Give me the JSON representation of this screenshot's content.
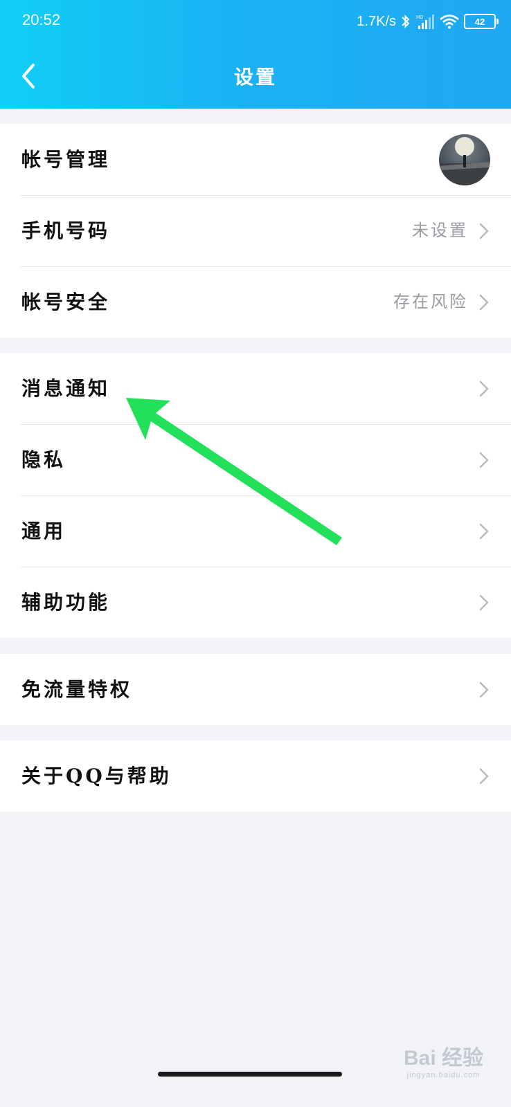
{
  "status_bar": {
    "time": "20:52",
    "net_speed": "1.7K/s",
    "signal_badge": "HD",
    "battery": "42",
    "icons": [
      "bluetooth-icon",
      "signal-icon",
      "wifi-icon",
      "battery-icon"
    ]
  },
  "nav": {
    "title": "设置",
    "back_icon": "chevron-left-icon"
  },
  "groups": [
    {
      "rows": [
        {
          "label": "帐号管理",
          "value": "",
          "trailing": "avatar"
        },
        {
          "label": "手机号码",
          "value": "未设置",
          "trailing": "chevron"
        },
        {
          "label": "帐号安全",
          "value": "存在风险",
          "trailing": "chevron"
        }
      ]
    },
    {
      "rows": [
        {
          "label": "消息通知",
          "value": "",
          "trailing": "chevron"
        },
        {
          "label": "隐私",
          "value": "",
          "trailing": "chevron"
        },
        {
          "label": "通用",
          "value": "",
          "trailing": "chevron"
        },
        {
          "label": "辅助功能",
          "value": "",
          "trailing": "chevron"
        }
      ]
    },
    {
      "rows": [
        {
          "label": "免流量特权",
          "value": "",
          "trailing": "chevron"
        }
      ]
    },
    {
      "rows": [
        {
          "label": "关于QQ与帮助",
          "value": "",
          "trailing": "chevron"
        }
      ]
    }
  ],
  "watermark": {
    "main": "Bai 经验",
    "sub": "jingyan.baidu.com"
  },
  "colors": {
    "header_start": "#10cff5",
    "header_end": "#20a7f2",
    "arrow": "#22e05a",
    "background": "#f2f3f7"
  }
}
